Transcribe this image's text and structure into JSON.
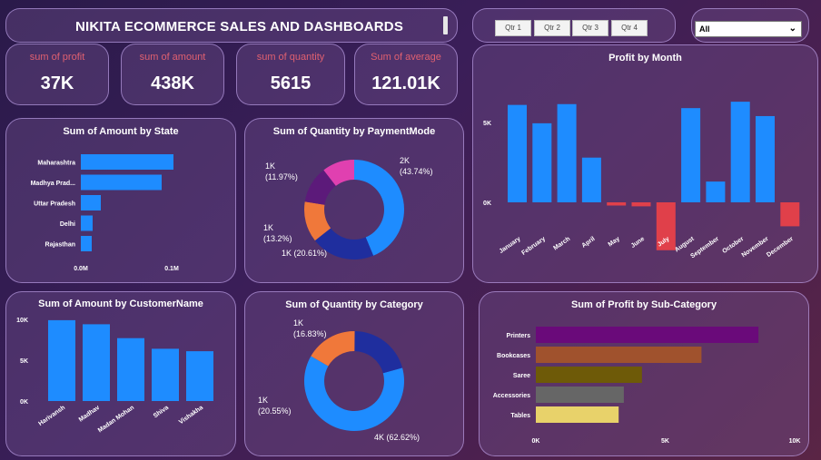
{
  "header": {
    "title": "NIKITA ECOMMERCE SALES AND DASHBOARDS"
  },
  "slicer": {
    "quarters": [
      "Qtr 1",
      "Qtr 2",
      "Qtr 3",
      "Qtr 4"
    ],
    "dropdown_value": "All"
  },
  "kpis": [
    {
      "label": "sum of profit",
      "value": "37K"
    },
    {
      "label": "sum of amount",
      "value": "438K"
    },
    {
      "label": "sum of quantity",
      "value": "5615"
    },
    {
      "label": "Sum of average",
      "value": "121.01K"
    }
  ],
  "colors": {
    "blue": "#1e8cff",
    "kpi_label": "#e06070",
    "navy": "#1f2e9e",
    "orange": "#f0783a",
    "purple": "#5c1a7a",
    "pink": "#e040b0",
    "red": "#e0404a"
  },
  "chart_data": [
    {
      "type": "bar",
      "orientation": "horizontal",
      "title": "Sum of Amount by State",
      "categories": [
        "Maharashtra",
        "Madhya Prad...",
        "Uttar Pradesh",
        "Delhi",
        "Rajasthan"
      ],
      "values": [
        0.102,
        0.089,
        0.022,
        0.013,
        0.012
      ],
      "tick_labels": [
        "0.0M",
        "0.1M"
      ],
      "xlim": [
        0,
        0.135
      ]
    },
    {
      "type": "pie",
      "donut": true,
      "title": "Sum of Quantity by PaymentMode",
      "slices": [
        {
          "value": 43.74,
          "label_count": "2K",
          "label_pct": "(43.74%)",
          "color": "#1e8cff"
        },
        {
          "value": 20.61,
          "label_count": "1K",
          "label_pct": "(20.61%)",
          "color": "#1f2e9e"
        },
        {
          "value": 13.2,
          "label_count": "1K",
          "label_pct": "(13.2%)",
          "color": "#f0783a"
        },
        {
          "value": 11.97,
          "label_count": "1K",
          "label_pct": "(11.97%)",
          "color": "#5c1a7a"
        },
        {
          "value": 10.48,
          "label_count": "",
          "label_pct": "",
          "color": "#e040b0"
        }
      ]
    },
    {
      "type": "bar",
      "title": "Profit by Month",
      "categories": [
        "January",
        "February",
        "March",
        "April",
        "May",
        "June",
        "July",
        "August",
        "September",
        "October",
        "November",
        "December"
      ],
      "values": [
        6100,
        4950,
        6150,
        2800,
        -200,
        -250,
        -3000,
        5900,
        1300,
        6300,
        5400,
        -1500
      ],
      "tick_labels": [
        "0K",
        "5K"
      ],
      "ylim": [
        -4500,
        8500
      ]
    },
    {
      "type": "bar",
      "title": "Sum of Amount by CustomerName",
      "categories": [
        "Harivansh",
        "Madhav",
        "Madan Mohan",
        "Shiva",
        "Vishakha"
      ],
      "values": [
        9900,
        9400,
        7700,
        6400,
        6100
      ],
      "tick_labels": [
        "0K",
        "5K",
        "10K"
      ],
      "ylim": [
        0,
        10000
      ]
    },
    {
      "type": "pie",
      "donut": true,
      "title": "Sum of Quantity by Category",
      "slices": [
        {
          "value": 62.62,
          "label_count": "4K",
          "label_pct": "(62.62%)",
          "color": "#1e8cff"
        },
        {
          "value": 20.55,
          "label_count": "1K",
          "label_pct": "(20.55%)",
          "color": "#1f2e9e"
        },
        {
          "value": 16.83,
          "label_count": "1K",
          "label_pct": "(16.83%)",
          "color": "#f0783a"
        }
      ]
    },
    {
      "type": "bar",
      "orientation": "horizontal",
      "title": "Sum of Profit by Sub-Category",
      "categories": [
        "Printers",
        "Bookcases",
        "Saree",
        "Accessories",
        "Tables"
      ],
      "values": [
        8600,
        6400,
        4100,
        3400,
        3200
      ],
      "colors": [
        "#6a0a7a",
        "#a0522d",
        "#6e5a08",
        "#666666",
        "#e8d26a"
      ],
      "tick_labels": [
        "0K",
        "5K",
        "10K"
      ],
      "xlim": [
        0,
        10000
      ]
    }
  ]
}
